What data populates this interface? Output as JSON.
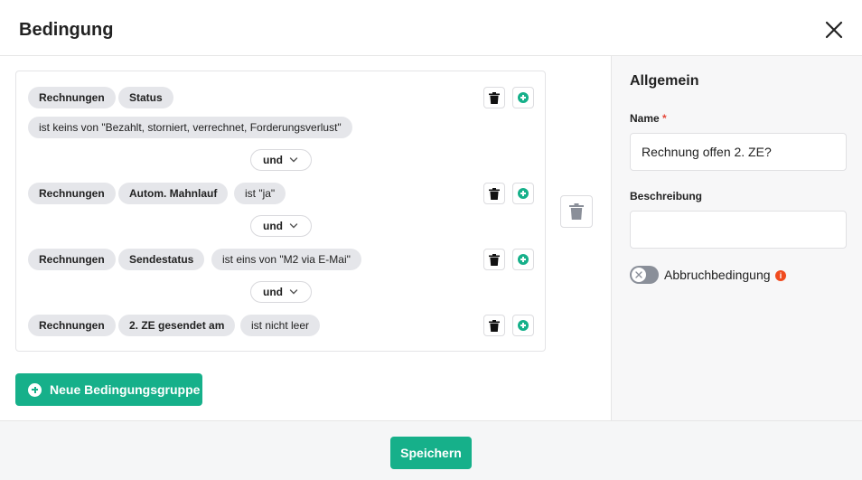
{
  "dialog": {
    "title": "Bedingung",
    "close_icon": "close-icon"
  },
  "conditions": {
    "rows": [
      {
        "object": "Rechnungen",
        "field": "Status",
        "operator": "ist keins von \"Bezahlt, storniert, verrechnet, Forderungsverlust\""
      },
      {
        "object": "Rechnungen",
        "field": "Autom. Mahnlauf",
        "operator": "ist \"ja\""
      },
      {
        "object": "Rechnungen",
        "field": "Sendestatus",
        "operator": "ist eins von \"M2 via E-Mai\""
      },
      {
        "object": "Rechnungen",
        "field": "2. ZE gesendet am",
        "operator": "ist nicht leer"
      }
    ],
    "connectors": [
      "und",
      "und",
      "und"
    ]
  },
  "new_group_label": "Neue Bedingungsgruppe",
  "general": {
    "title": "Allgemein",
    "name_label": "Name",
    "name_required_mark": "*",
    "name_value": "Rechnung offen 2. ZE?",
    "description_label": "Beschreibung",
    "description_value": "",
    "abort_label": "Abbruchbedingung",
    "abort_enabled": false,
    "info_glyph": "i"
  },
  "footer": {
    "save_label": "Speichern"
  },
  "colors": {
    "accent": "#16b08a",
    "chip": "#e5e6ea",
    "info": "#f04a1e",
    "toggle_off": "#8a8f99"
  }
}
